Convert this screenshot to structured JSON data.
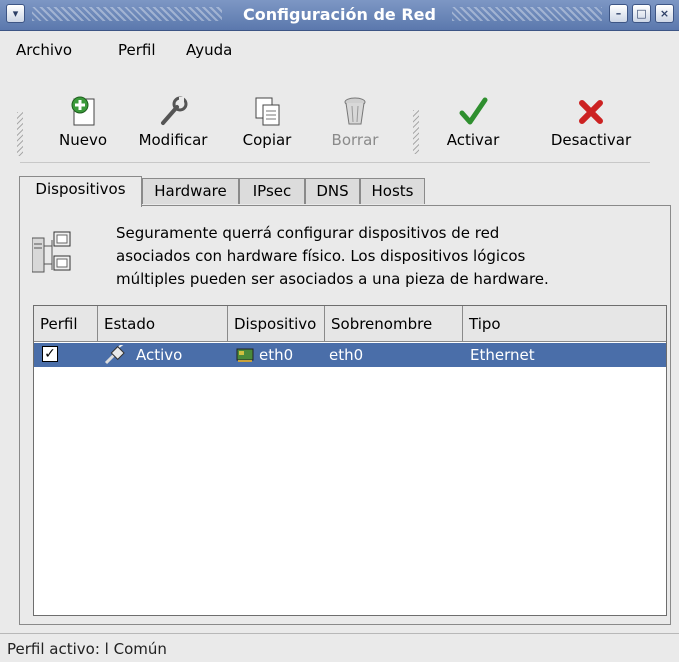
{
  "window": {
    "title": "Configuración de Red",
    "buttons": {
      "minimize": "–",
      "maximize": "□",
      "close": "×"
    }
  },
  "menu": {
    "items": [
      {
        "label": "Archivo"
      },
      {
        "label": "Perfil"
      },
      {
        "label": "Ayuda"
      }
    ]
  },
  "toolbar": {
    "buttons": [
      {
        "label": "Nuevo",
        "icon": "new-icon",
        "enabled": true
      },
      {
        "label": "Modificar",
        "icon": "wrench-icon",
        "enabled": true
      },
      {
        "label": "Copiar",
        "icon": "copy-icon",
        "enabled": true
      },
      {
        "label": "Borrar",
        "icon": "trash-icon",
        "enabled": false
      },
      {
        "label": "Activar",
        "icon": "checkmark-icon",
        "enabled": true
      },
      {
        "label": "Desactivar",
        "icon": "x-icon",
        "enabled": true
      }
    ]
  },
  "tabs": [
    {
      "label": "Dispositivos",
      "active": true
    },
    {
      "label": "Hardware",
      "active": false
    },
    {
      "label": "IPsec",
      "active": false
    },
    {
      "label": "DNS",
      "active": false
    },
    {
      "label": "Hosts",
      "active": false
    }
  ],
  "info": {
    "line1": "Seguramente querrá configurar dispositivos de red",
    "line2": "asociados con hardware físico. Los dispositivos lógicos",
    "line3": "múltiples pueden ser asociados a una pieza de hardware."
  },
  "table": {
    "columns": [
      "Perfil",
      "Estado",
      "Dispositivo",
      "Sobrenombre",
      "Tipo"
    ],
    "rows": [
      {
        "perfil_checked": true,
        "estado": "Activo",
        "dispositivo": "eth0",
        "sobrenombre": "eth0",
        "tipo": "Ethernet"
      }
    ]
  },
  "status": {
    "text": "Perfil activo: l Común"
  },
  "colors": {
    "title_bar": "#5b78ad",
    "selection": "#4a6ea9"
  }
}
